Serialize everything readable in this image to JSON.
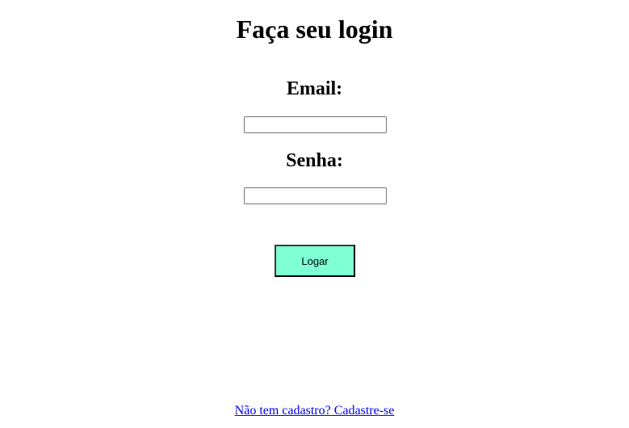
{
  "page": {
    "title": "Faça seu login"
  },
  "form": {
    "email_label": "Email:",
    "email_value": "",
    "password_label": "Senha:",
    "password_value": "",
    "submit_label": "Logar",
    "submit_color": "#7fffd4"
  },
  "footer": {
    "signup_link": "Não tem cadastro? Cadastre-se",
    "link_color": "#0000ee"
  }
}
